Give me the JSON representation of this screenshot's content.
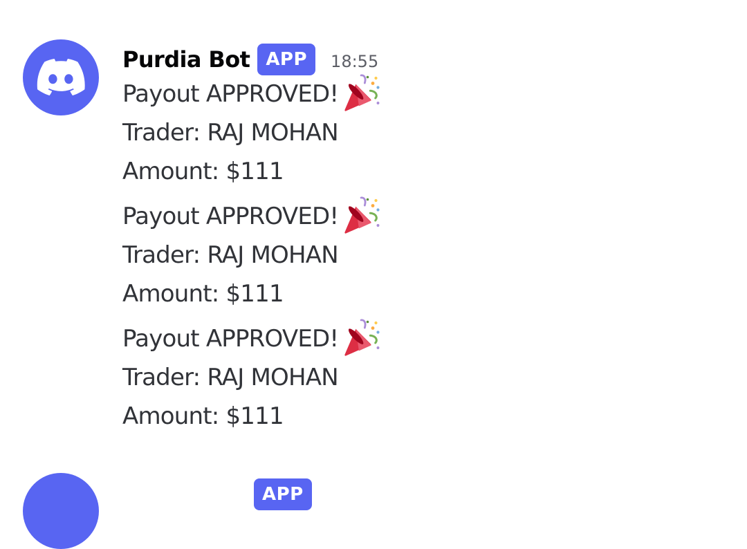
{
  "messages": [
    {
      "author": "Purdia Bot",
      "badge": "APP",
      "timestamp": "18:55",
      "payouts": [
        {
          "headline": "Payout APPROVED!",
          "trader": "Trader: RAJ MOHAN",
          "amount": "Amount: $111",
          "emoji": "party-popper-icon"
        },
        {
          "headline": "Payout APPROVED!",
          "trader": "Trader: RAJ MOHAN",
          "amount": "Amount: $111",
          "emoji": "party-popper-icon"
        },
        {
          "headline": "Payout APPROVED!",
          "trader": "Trader: RAJ MOHAN",
          "amount": "Amount: $111",
          "emoji": "party-popper-icon"
        }
      ]
    },
    {
      "badge": "APP"
    }
  ],
  "colors": {
    "blurple": "#5865f2",
    "text": "#313338",
    "muted": "#5c5e66"
  }
}
